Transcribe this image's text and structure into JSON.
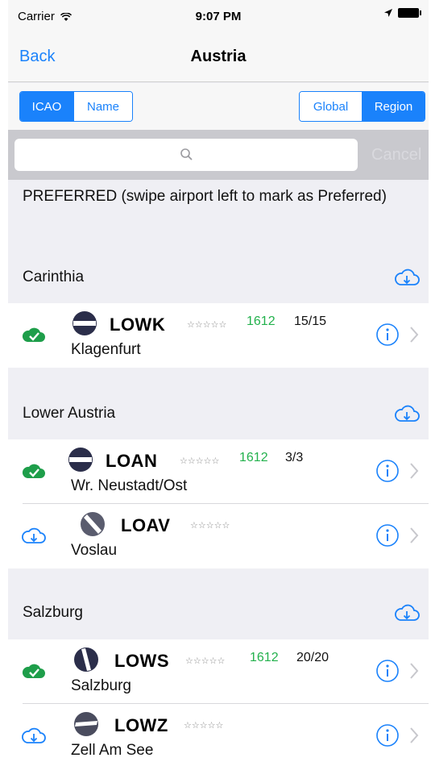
{
  "status_bar": {
    "carrier": "Carrier",
    "time": "9:07 PM"
  },
  "nav": {
    "back_label": "Back",
    "title": "Austria"
  },
  "segments": {
    "sort": {
      "options": [
        "ICAO",
        "Name"
      ],
      "selected": "ICAO"
    },
    "scope": {
      "options": [
        "Global",
        "Region"
      ],
      "selected": "Region"
    }
  },
  "search": {
    "placeholder": "",
    "cancel_label": "Cancel"
  },
  "preferred_header": "PREFERRED (swipe airport left to mark as Preferred)",
  "sections": [
    {
      "name": "Carinthia",
      "airports": [
        {
          "code": "LOWK",
          "stars": "☆☆☆☆☆",
          "cycle": "1612",
          "count": "15/15",
          "name": "Klagenfurt",
          "downloaded": true,
          "runway_icon": "runway-horizontal-icon"
        }
      ]
    },
    {
      "name": "Lower Austria",
      "airports": [
        {
          "code": "LOAN",
          "stars": "☆☆☆☆☆",
          "cycle": "1612",
          "count": "3/3",
          "name": "Wr. Neustadt/Ost",
          "downloaded": true,
          "runway_icon": "runway-horizontal-icon"
        },
        {
          "code": "LOAV",
          "stars": "☆☆☆☆☆",
          "cycle": "",
          "count": "",
          "name": "Voslau",
          "downloaded": false,
          "runway_icon": "runway-diagonal-icon"
        }
      ]
    },
    {
      "name": "Salzburg",
      "airports": [
        {
          "code": "LOWS",
          "stars": "☆☆☆☆☆",
          "cycle": "1612",
          "count": "20/20",
          "name": "Salzburg",
          "downloaded": true,
          "runway_icon": "runway-steep-icon"
        },
        {
          "code": "LOWZ",
          "stars": "☆☆☆☆☆",
          "cycle": "",
          "count": "",
          "name": "Zell Am See",
          "downloaded": false,
          "runway_icon": "runway-slight-icon"
        }
      ]
    }
  ],
  "colors": {
    "accent": "#1a82fb",
    "downloaded_green": "#1e9e4a",
    "cycle_green": "#22b14c"
  },
  "icons": {
    "cloud_download": "cloud-download-icon",
    "cloud_check": "cloud-check-icon",
    "info": "info-icon",
    "chevron": "chevron-right-icon",
    "search": "search-icon"
  }
}
